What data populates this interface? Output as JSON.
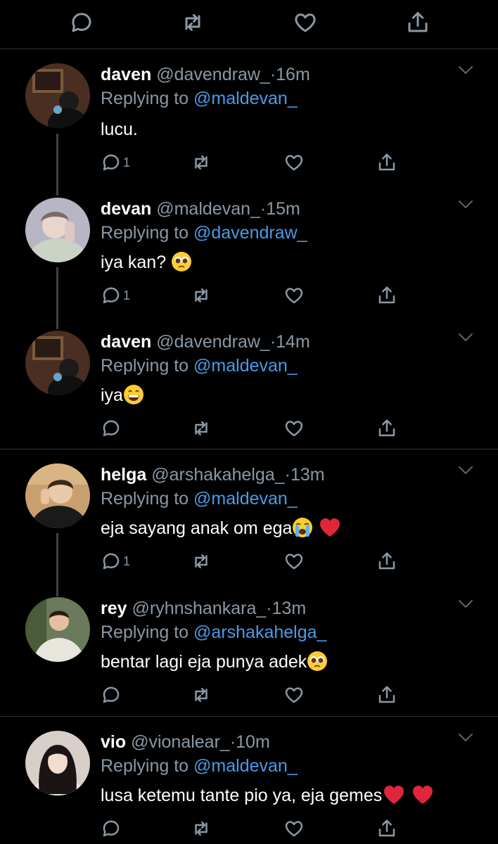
{
  "colors": {
    "background": "#000000",
    "text": "#ffffff",
    "secondary": "#8899a6",
    "link": "#4a9be8",
    "divider": "#2f3336"
  },
  "top_actions": [
    "reply-icon",
    "retweet-icon",
    "like-icon",
    "share-icon"
  ],
  "tweets": [
    {
      "name": "daven",
      "handle": "@davendraw_",
      "sep": "·",
      "time": "16m",
      "replying_prefix": "Replying to ",
      "replying_to": "@maldevan_",
      "text": "lucu.",
      "reply_count": "1"
    },
    {
      "name": "devan",
      "handle": "@maldevan_",
      "sep": "·",
      "time": "15m",
      "replying_prefix": "Replying to ",
      "replying_to": "@davendraw_",
      "text": "iya kan?",
      "text_emoji": [
        "pleading-face"
      ],
      "reply_count": "1"
    },
    {
      "name": "daven",
      "handle": "@davendraw_",
      "sep": "·",
      "time": "14m",
      "replying_prefix": "Replying to ",
      "replying_to": "@maldevan_",
      "text": "iya",
      "text_emoji": [
        "grinning-face"
      ],
      "reply_count": ""
    },
    {
      "name": "helga",
      "handle": "@arshakahelga_",
      "sep": "·",
      "time": "13m",
      "replying_prefix": "Replying to ",
      "replying_to": "@maldevan_",
      "text": "eja sayang anak om ega",
      "text_emoji": [
        "loudly-crying-face",
        "red-heart"
      ],
      "reply_count": "1"
    },
    {
      "name": "rey",
      "handle": "@ryhnshankara_",
      "sep": "·",
      "time": "13m",
      "replying_prefix": "Replying to ",
      "replying_to": "@arshakahelga_",
      "text": "bentar lagi eja punya adek",
      "text_emoji": [
        "pleading-face"
      ],
      "reply_count": ""
    },
    {
      "name": "vio",
      "handle": "@vionalear_",
      "sep": "·",
      "time": "10m",
      "replying_prefix": "Replying to ",
      "replying_to": "@maldevan_",
      "text": "lusa ketemu tante pio ya, eja gemes",
      "text_emoji": [
        "red-heart",
        "red-heart"
      ],
      "reply_count": ""
    }
  ]
}
